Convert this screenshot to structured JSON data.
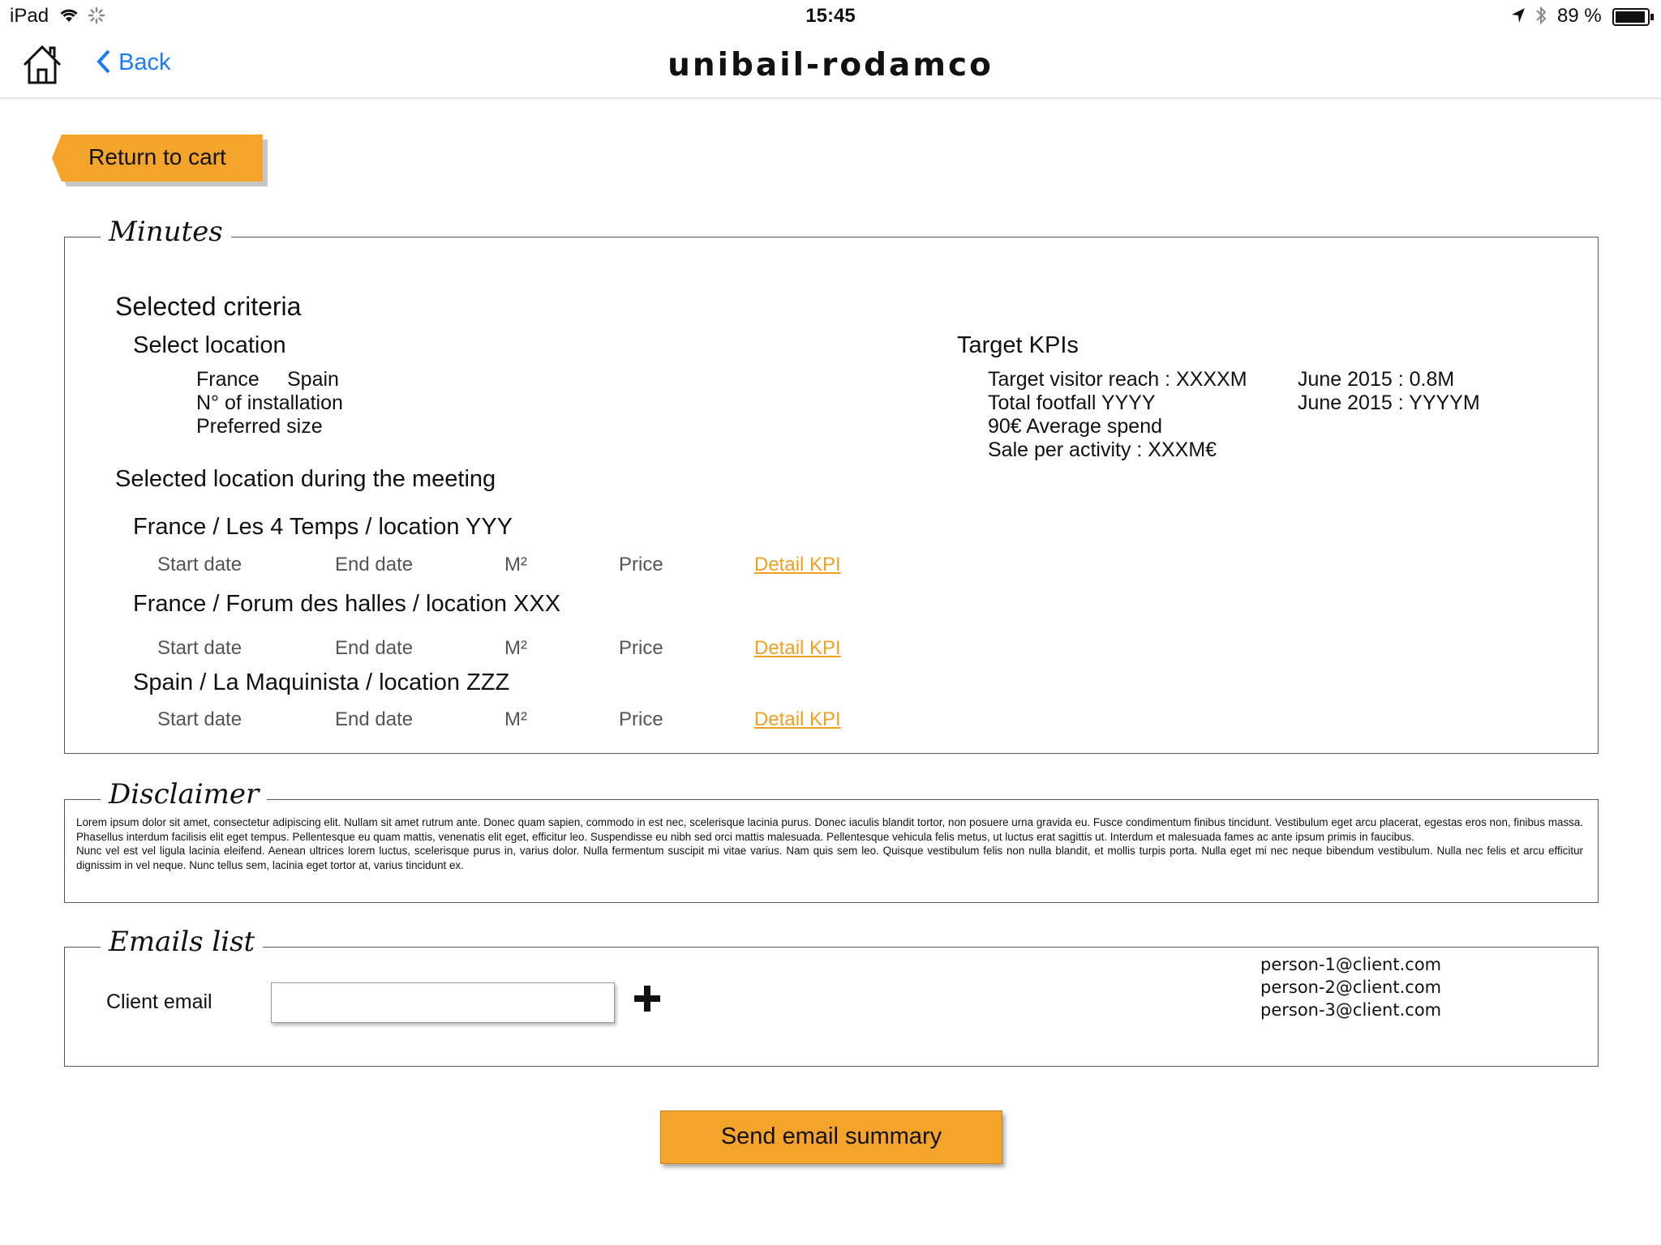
{
  "status_bar": {
    "device": "iPad",
    "time": "15:45",
    "battery": "89 %"
  },
  "nav": {
    "back_label": "Back",
    "title": "unibail-rodamco"
  },
  "return_to_cart": "Return to cart",
  "minutes": {
    "legend": "Minutes",
    "selected_criteria": "Selected criteria",
    "select_location": "Select location",
    "countries": [
      "France",
      "Spain"
    ],
    "installation": "N° of installation",
    "preferred_size": "Preferred size",
    "target_kpis": {
      "title": "Target KPIs",
      "left": [
        "Target visitor reach : XXXXM",
        "Total footfall YYYY",
        "90€ Average spend",
        "Sale per activity : XXXM€"
      ],
      "right": [
        "June 2015 : 0.8M",
        "June 2015 : YYYYM"
      ]
    },
    "selected_location_title": "Selected location during the meeting",
    "locations": [
      {
        "name": "France / Les 4 Temps / location YYY",
        "start": "Start date",
        "end": "End date",
        "area": "M²",
        "price": "Price",
        "link": "Detail KPI"
      },
      {
        "name": "France / Forum des halles / location XXX",
        "start": "Start date",
        "end": "End date",
        "area": "M²",
        "price": "Price",
        "link": "Detail KPI"
      },
      {
        "name": "Spain / La Maquinista / location ZZZ",
        "start": "Start date",
        "end": "End date",
        "area": "M²",
        "price": "Price",
        "link": "Detail KPI"
      }
    ]
  },
  "disclaimer": {
    "legend": "Disclaimer",
    "paragraph1": "Lorem ipsum dolor sit amet, consectetur adipiscing elit. Nullam sit amet rutrum ante. Donec quam sapien, commodo in est nec, scelerisque lacinia purus. Donec iaculis blandit tortor, non posuere urna gravida eu. Fusce condimentum finibus tincidunt. Vestibulum eget arcu placerat, egestas eros non, finibus massa. Phasellus interdum facilisis elit eget tempus. Pellentesque eu quam mattis, venenatis elit eget, efficitur leo. Suspendisse eu nibh sed orci mattis malesuada. Pellentesque vehicula felis metus, ut luctus erat sagittis ut. Interdum et malesuada fames ac ante ipsum primis in faucibus.",
    "paragraph2": "Nunc vel est vel ligula lacinia eleifend. Aenean ultrices lorem luctus, scelerisque purus in, varius dolor. Nulla fermentum suscipit mi vitae varius. Nam quis sem leo. Quisque vestibulum felis non nulla blandit, et mollis turpis porta. Nulla eget mi nec neque bibendum vestibulum. Nulla nec felis et arcu efficitur dignissim in vel neque. Nunc tellus sem, lacinia eget tortor at, varius tincidunt ex."
  },
  "emails": {
    "legend": "Emails list",
    "client_email_label": "Client email",
    "input_value": "",
    "list": [
      "person-1@client.com",
      "person-2@client.com",
      "person-3@client.com"
    ]
  },
  "send_button": "Send email summary",
  "colors": {
    "accent": "#f4a42a",
    "link": "#f0a020",
    "ios_blue": "#1a7cf6"
  }
}
